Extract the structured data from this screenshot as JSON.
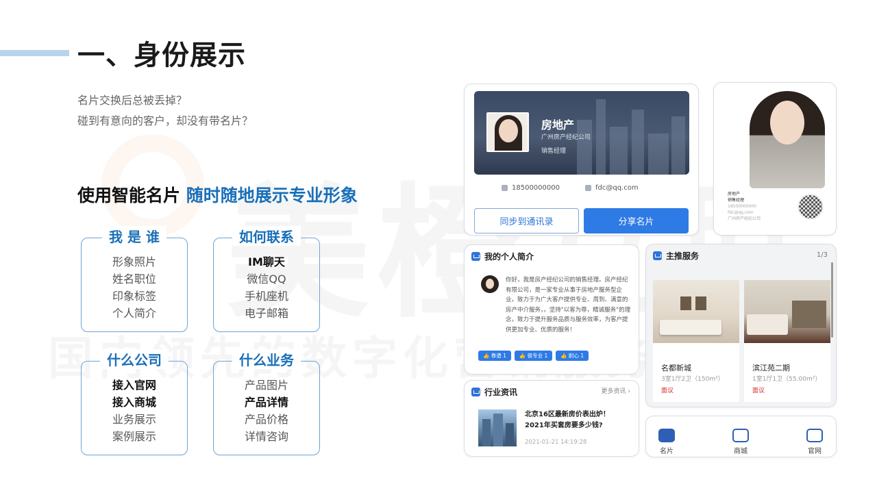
{
  "header": {
    "title": "一、身份展示"
  },
  "intro": [
    "名片交换后总被丢掉？",
    "碰到有意向的客户，却没有带名片？"
  ],
  "headline": {
    "main": "使用智能名片",
    "highlight": "随时随地展示专业形象"
  },
  "features": [
    {
      "title": "我 是 谁",
      "items": [
        "形象照片",
        "姓名职位",
        "印象标签",
        "个人简介"
      ],
      "bold": []
    },
    {
      "title": "如何联系",
      "items": [
        "IM聊天",
        "微信QQ",
        "手机座机",
        "电子邮箱"
      ],
      "bold": [
        0
      ]
    },
    {
      "title": "什么公司",
      "items": [
        "接入官网",
        "接入商城",
        "业务展示",
        "案例展示"
      ],
      "bold": [
        0,
        1
      ]
    },
    {
      "title": "什么业务",
      "items": [
        "产品图片",
        "产品详情",
        "产品价格",
        "详情咨询"
      ],
      "bold": [
        1
      ]
    }
  ],
  "business_card": {
    "name": "房地产",
    "company": "广州房产经纪公司",
    "position": "销售经理",
    "phone": "18500000000",
    "email": "fdc@qq.com",
    "btn_sync": "同步到通讯录",
    "btn_share": "分享名片"
  },
  "portrait_card": {
    "name": "房地产",
    "position": "销售经理",
    "phone": "18500000000",
    "email": "fdc@qq.com",
    "company": "广州房产经纪公司"
  },
  "profile": {
    "heading": "我的个人简介",
    "text": "你好，我是房产经纪公司的销售经理。房产经纪有限公司，是一家专业从事于房地产服务型企业，致力于为广大客户提供专业、周到、满意的房产中介服务，，坚持\"以客为尊，精诚服务\"的理念，致力于提升服务品质与服务效率，为客户提供更加专业、优质的服务！",
    "tags": [
      "👍 靠谱 1",
      "👍 很专业 1",
      "👍 耐心 1"
    ]
  },
  "services": {
    "heading": "主推服务",
    "page": "1/3",
    "items": [
      {
        "name": "名都新城",
        "spec": "3室1厅2卫（150m²）",
        "price": "面议"
      },
      {
        "name": "滨江苑二期",
        "spec": "1室1厅1卫（55.00m²）",
        "price": "面议"
      }
    ]
  },
  "news": {
    "heading": "行业资讯",
    "more": "更多资讯 ›",
    "title": "北京16区最新房价表出炉！2021年买套房要多少钱?",
    "time": "2021-01-21 14:19:28"
  },
  "bottom_nav": [
    {
      "label": "名片",
      "icon": "card-icon"
    },
    {
      "label": "商城",
      "icon": "shop-icon"
    },
    {
      "label": "官网",
      "icon": "website-icon"
    }
  ],
  "colors": {
    "accent": "#1a6fb8",
    "button": "#2e7be6",
    "price": "#d0312d"
  }
}
